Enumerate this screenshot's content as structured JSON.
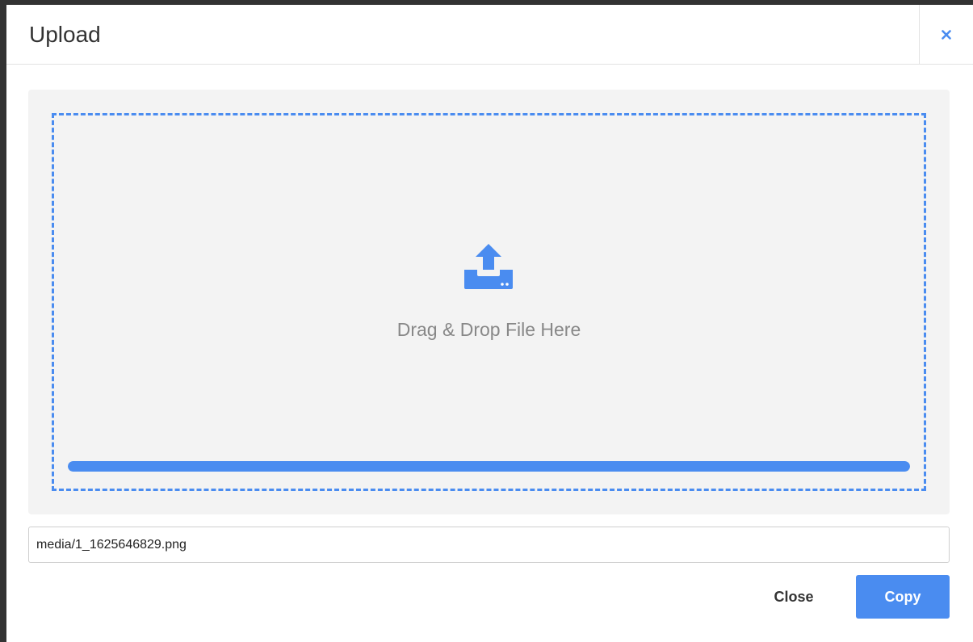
{
  "modal": {
    "title": "Upload",
    "close_icon": "close-icon"
  },
  "dropzone": {
    "icon": "upload-icon",
    "text": "Drag & Drop File Here",
    "progress_percent": 100
  },
  "path_field": {
    "value": "media/1_1625646829.png"
  },
  "footer": {
    "close_label": "Close",
    "copy_label": "Copy"
  },
  "colors": {
    "accent": "#4a8cf0",
    "panel_bg": "#f3f3f3",
    "drop_text": "#888888"
  }
}
